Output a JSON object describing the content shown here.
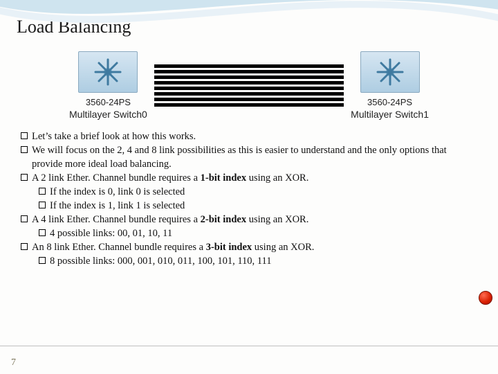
{
  "title": "Load Balancing",
  "diagram": {
    "left": {
      "part": "3560-24PS",
      "label": "Multilayer Switch0"
    },
    "right": {
      "part": "3560-24PS",
      "label": "Multilayer Switch1"
    },
    "link_count": 8
  },
  "bullets": {
    "b1": "Let’s take a brief look at how this works.",
    "b2": "We will focus on the 2, 4 and 8 link possibilities as this is easier to understand and the only options that provide more ideal load balancing.",
    "b3_pre": "A 2 link Ether. Channel bundle requires a ",
    "b3_b": "1-bit index",
    "b3_post": " using an XOR.",
    "b3a": "If the index is 0, link 0 is selected",
    "b3b": "If the index is 1, link 1 is selected",
    "b4_pre": "A 4 link Ether. Channel bundle requires a ",
    "b4_b": "2-bit index",
    "b4_post": " using an XOR.",
    "b4a": "4 possible links: 00, 01, 10, 11",
    "b5_pre": "An 8 link Ether. Channel bundle requires a ",
    "b5_b": "3-bit index",
    "b5_post": " using an XOR.",
    "b5a": "8 possible links: 000, 001, 010, 011, 100, 101, 110, 111"
  },
  "page_number": "7"
}
